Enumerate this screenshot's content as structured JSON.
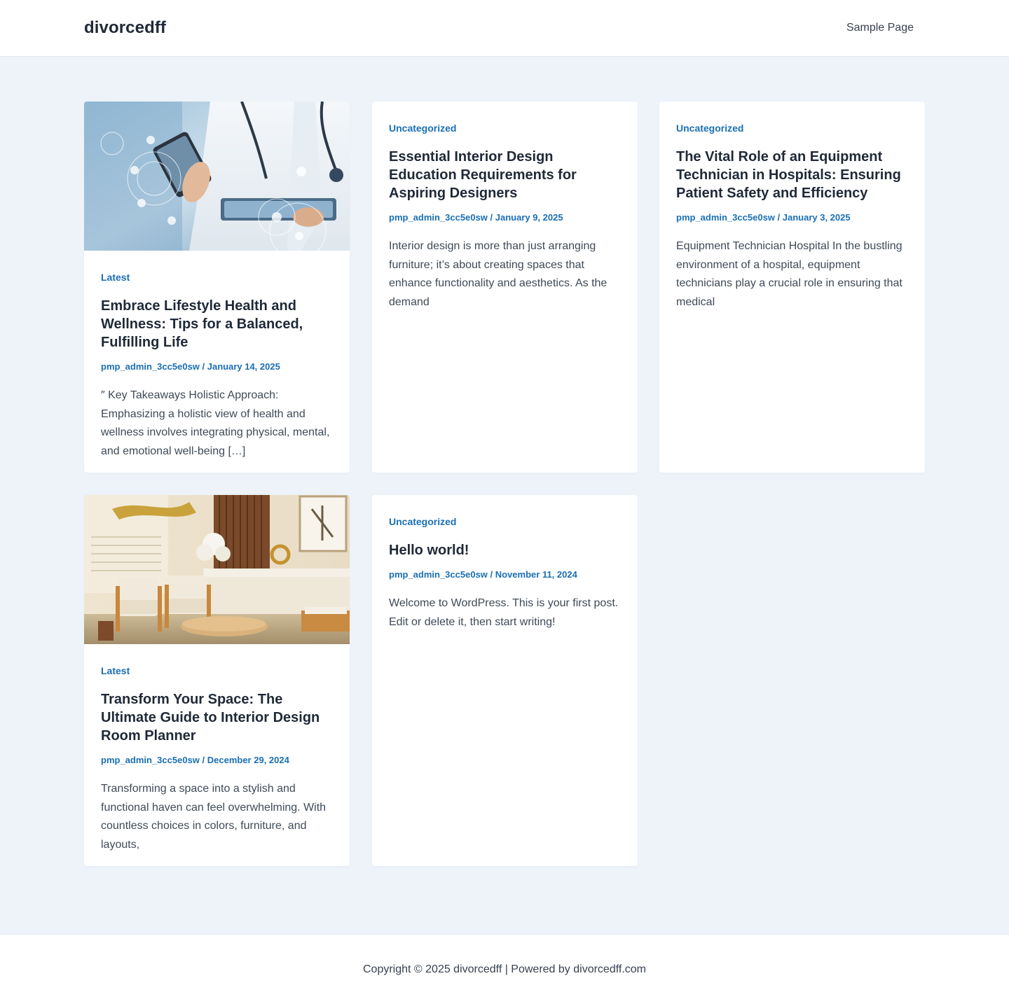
{
  "header": {
    "site_title": "divorcedff",
    "nav": [
      "Sample Page"
    ]
  },
  "posts": [
    {
      "category": "Latest",
      "title": "Embrace Lifestyle Health and Wellness: Tips for a Balanced, Fulfilling Life",
      "author": "pmp_admin_3cc5e0sw",
      "date": "January 14, 2025",
      "excerpt": "″ Key Takeaways Holistic Approach: Emphasizing a holistic view of health and wellness involves integrating physical, mental, and emotional well-being […]",
      "image": "doctor-with-tablet-photo"
    },
    {
      "category": "Uncategorized",
      "title": "Essential Interior Design Education Requirements for Aspiring Designers",
      "author": "pmp_admin_3cc5e0sw",
      "date": "January 9, 2025",
      "excerpt": "Interior design is more than just arranging furniture; it’s about creating spaces that enhance functionality and aesthetics. As the demand"
    },
    {
      "category": "Uncategorized",
      "title": "The Vital Role of an Equipment Technician in Hospitals: Ensuring Patient Safety and Efficiency",
      "author": "pmp_admin_3cc5e0sw",
      "date": "January 3, 2025",
      "excerpt": "Equipment Technician Hospital In the bustling environment of a hospital, equipment technicians play a crucial role in ensuring that medical"
    },
    {
      "category": "Latest",
      "title": "Transform Your Space: The Ultimate Guide to Interior Design Room Planner",
      "author": "pmp_admin_3cc5e0sw",
      "date": "December 29, 2024",
      "excerpt": "Transforming a space into a stylish and functional haven can feel overwhelming. With countless choices in colors, furniture, and layouts,",
      "image": "interior-lounge-photo"
    },
    {
      "category": "Uncategorized",
      "title": "Hello world!",
      "author": "pmp_admin_3cc5e0sw",
      "date": "November 11, 2024",
      "excerpt": "Welcome to WordPress. This is your first post. Edit or delete it, then start writing!"
    }
  ],
  "meta_separator": " / ",
  "footer": {
    "copyright": "Copyright © 2025 divorcedff | Powered by divorcedff.com"
  },
  "colors": {
    "accent": "#1a6fb5",
    "page_background": "#eef3f9",
    "card_background": "#ffffff"
  }
}
